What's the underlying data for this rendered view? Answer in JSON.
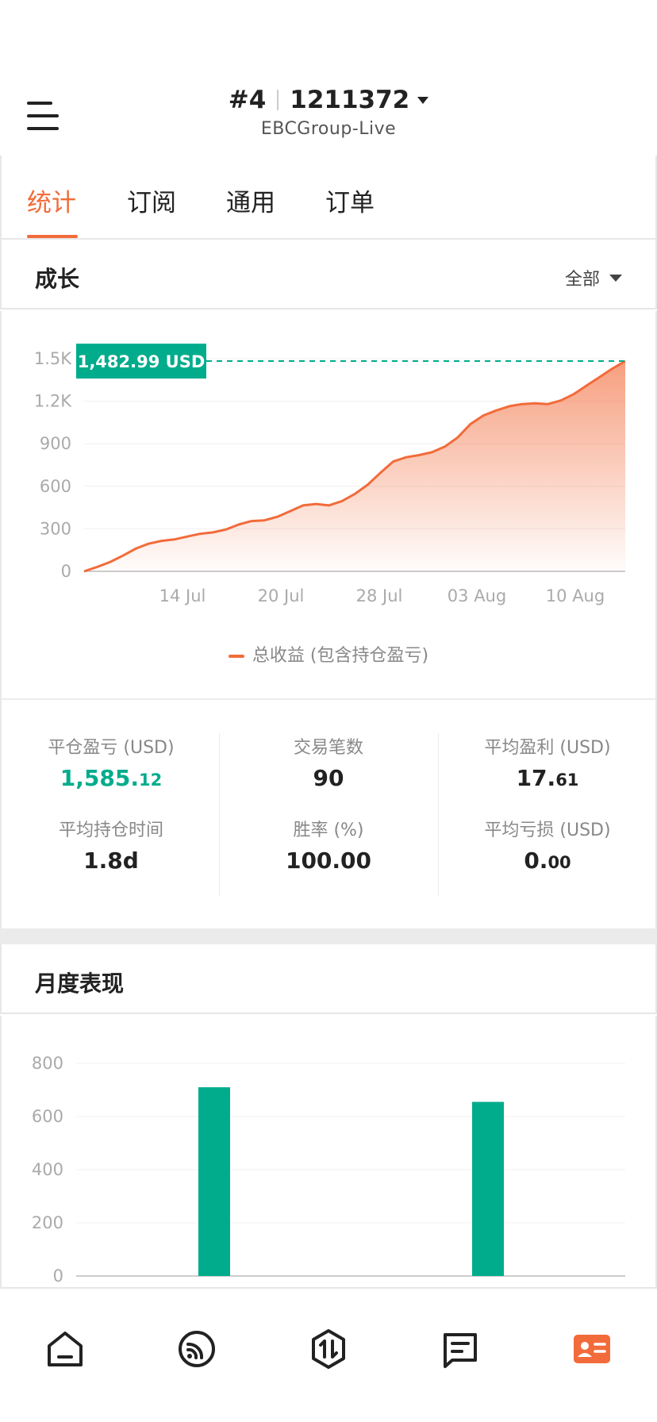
{
  "header": {
    "account_num": "#4",
    "account_id": "1211372",
    "server": "EBCGroup-Live"
  },
  "tabs": [
    "统计",
    "订阅",
    "通用",
    "订单"
  ],
  "active_tab": 0,
  "growth": {
    "title": "成长",
    "range_label": "全部",
    "current_label": "1,482.99 USD",
    "legend": "总收益 (包含持仓盈亏)"
  },
  "chart_data": [
    {
      "type": "area",
      "x_tick_labels": [
        "14 Jul",
        "20 Jul",
        "28 Jul",
        "03 Aug",
        "10 Aug"
      ],
      "y_tick_labels": [
        "0",
        "300",
        "600",
        "900",
        "1.2K",
        "1.5K"
      ],
      "ylim": [
        0,
        1500
      ],
      "grid": true,
      "legend_position": "bottom-center",
      "series": [
        {
          "name": "总收益 (包含持仓盈亏)",
          "color": "#f26b3a",
          "values": [
            0,
            30,
            65,
            110,
            160,
            195,
            215,
            225,
            245,
            265,
            275,
            295,
            330,
            355,
            360,
            385,
            425,
            465,
            475,
            465,
            495,
            545,
            610,
            695,
            775,
            805,
            820,
            840,
            880,
            945,
            1040,
            1100,
            1135,
            1165,
            1180,
            1185,
            1180,
            1205,
            1250,
            1310,
            1370,
            1430,
            1482.99
          ]
        }
      ],
      "current_value": 1482.99
    },
    {
      "type": "bar",
      "y_tick_labels": [
        "0",
        "200",
        "400",
        "600",
        "800"
      ],
      "ylim": [
        0,
        800
      ],
      "grid": true,
      "values": [
        710,
        655
      ],
      "color": "#00ac8c"
    }
  ],
  "stats": [
    {
      "label": "平仓盈亏 (USD)",
      "int": "1,585.",
      "dec": "12",
      "color": "green"
    },
    {
      "label": "交易笔数",
      "int": "90",
      "dec": "",
      "color": "default"
    },
    {
      "label": "平均盈利 (USD)",
      "int": "17.",
      "dec": "61",
      "color": "default"
    },
    {
      "label": "平均持仓时间",
      "int": "1.8d",
      "dec": "",
      "color": "default"
    },
    {
      "label": "胜率 (%)",
      "int": "100.00",
      "dec": "",
      "color": "default"
    },
    {
      "label": "平均亏损 (USD)",
      "int": "0.",
      "dec": "00",
      "color": "default"
    }
  ],
  "monthly": {
    "title": "月度表现"
  },
  "nav": [
    {
      "icon": "home-icon",
      "active": false
    },
    {
      "icon": "signal-icon",
      "active": false
    },
    {
      "icon": "trade-icon",
      "active": false
    },
    {
      "icon": "news-icon",
      "active": false
    },
    {
      "icon": "profile-card-icon",
      "active": true
    }
  ],
  "colors": {
    "accent": "#f26b3a",
    "green": "#00ac8c"
  }
}
